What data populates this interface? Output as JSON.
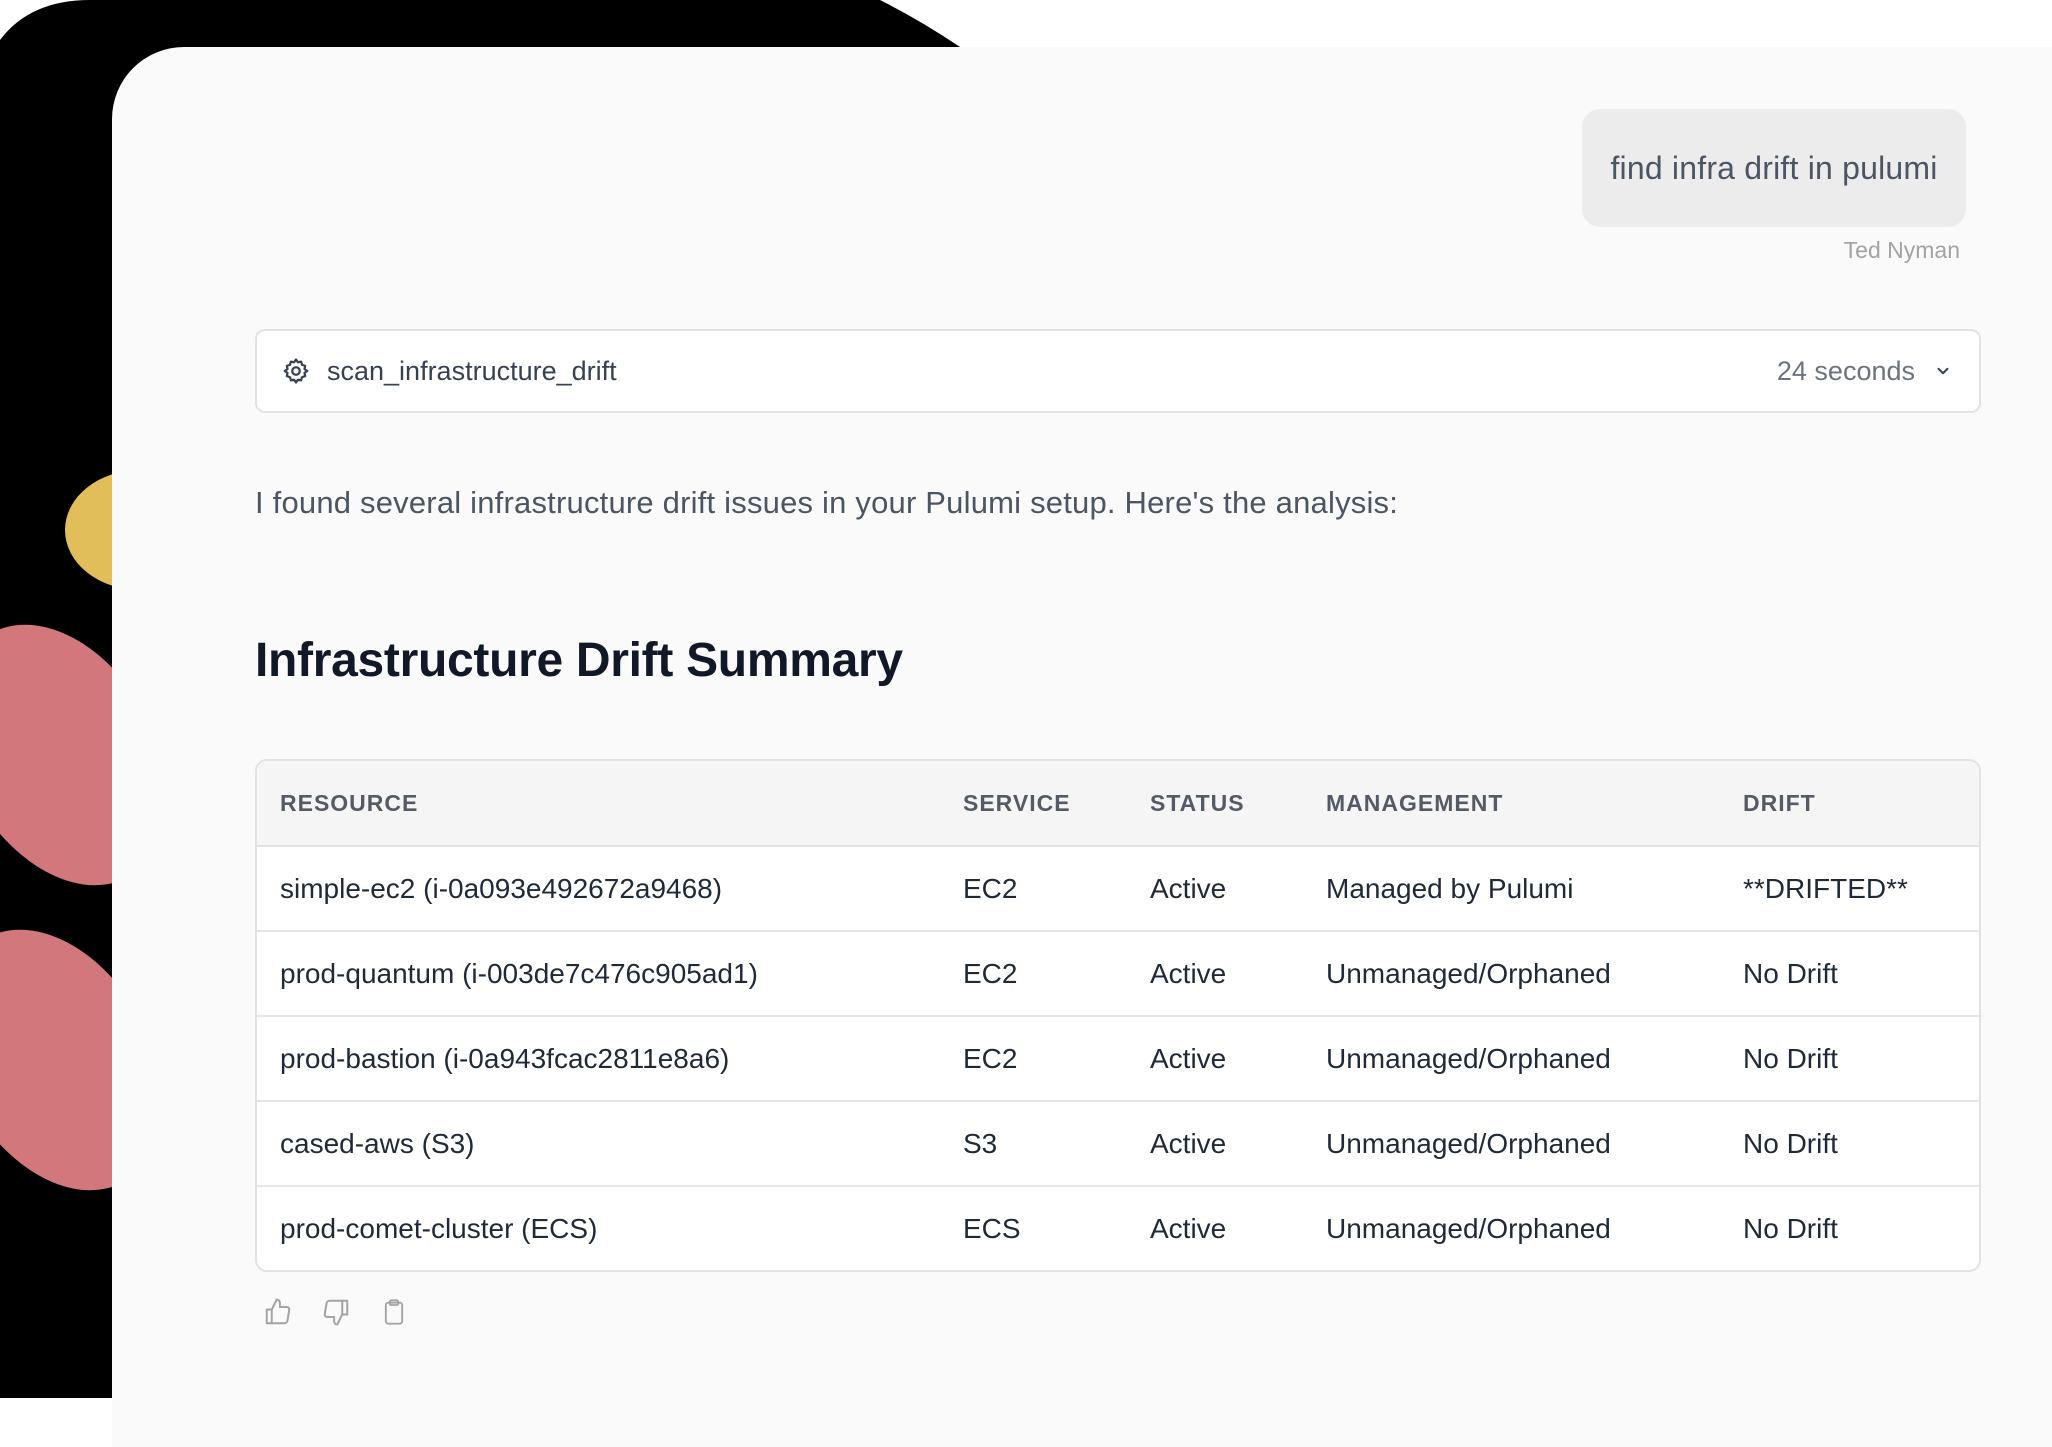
{
  "colors": {
    "backdrop_black": "#000000",
    "blob_yellow": "#e2be5a",
    "blob_pink": "#d2777c",
    "window_bg": "#fafafa",
    "bubble_bg": "#ececec"
  },
  "chat": {
    "user_message": "find infra drift in pulumi",
    "user_name": "Ted Nyman"
  },
  "tool_call": {
    "icon": "gear-icon",
    "name": "scan_infrastructure_drift",
    "duration": "24 seconds",
    "toggle_icon": "chevron-down-icon"
  },
  "response": {
    "intro": "I found several infrastructure drift issues in your Pulumi setup. Here's the analysis:",
    "heading": "Infrastructure Drift Summary"
  },
  "table": {
    "headers": [
      "RESOURCE",
      "SERVICE",
      "STATUS",
      "MANAGEMENT",
      "DRIFT"
    ],
    "rows": [
      [
        "simple-ec2 (i-0a093e492672a9468)",
        "EC2",
        "Active",
        "Managed by Pulumi",
        "**DRIFTED**"
      ],
      [
        "prod-quantum (i-003de7c476c905ad1)",
        "EC2",
        "Active",
        "Unmanaged/Orphaned",
        "No Drift"
      ],
      [
        "prod-bastion (i-0a943fcac2811e8a6)",
        "EC2",
        "Active",
        "Unmanaged/Orphaned",
        "No Drift"
      ],
      [
        "cased-aws (S3)",
        "S3",
        "Active",
        "Unmanaged/Orphaned",
        "No Drift"
      ],
      [
        "prod-comet-cluster (ECS)",
        "ECS",
        "Active",
        "Unmanaged/Orphaned",
        "No Drift"
      ]
    ]
  },
  "actions": [
    "thumbs-up-icon",
    "thumbs-down-icon",
    "clipboard-icon"
  ]
}
